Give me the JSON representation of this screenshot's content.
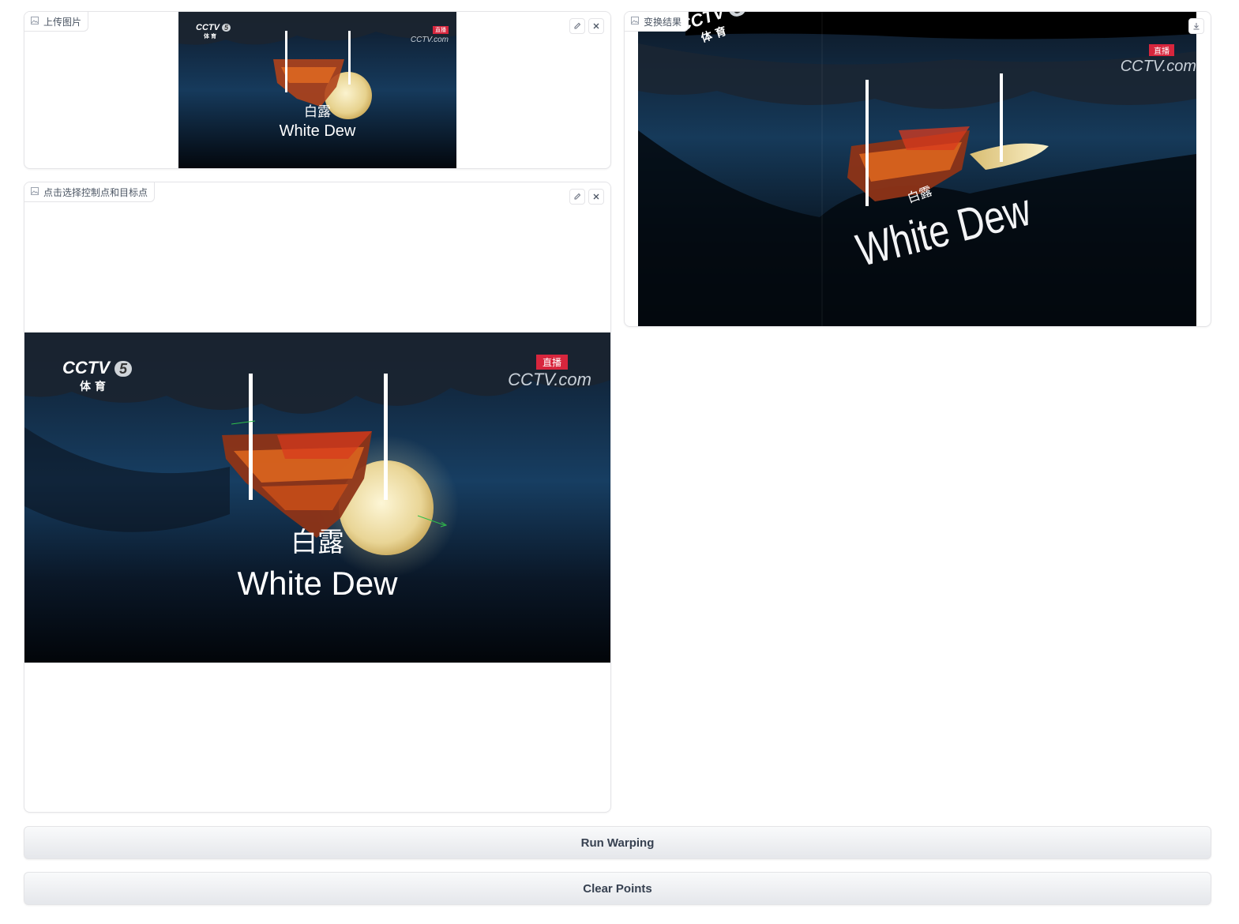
{
  "panels": {
    "upload": {
      "label": "上传图片"
    },
    "select": {
      "label": "点击选择控制点和目标点"
    },
    "result": {
      "label": "变换结果"
    }
  },
  "image_text": {
    "logo_main": "CCTV",
    "logo_num": "5",
    "logo_sub": "体 育",
    "live_badge": "直播",
    "site_logo": "CCTV.com",
    "caption_cn": "白露",
    "caption_en": "White Dew"
  },
  "buttons": {
    "run": "Run Warping",
    "clear": "Clear Points"
  },
  "icons": {
    "image": "image-icon",
    "edit": "edit-icon",
    "close": "close-icon",
    "download": "download-icon"
  }
}
